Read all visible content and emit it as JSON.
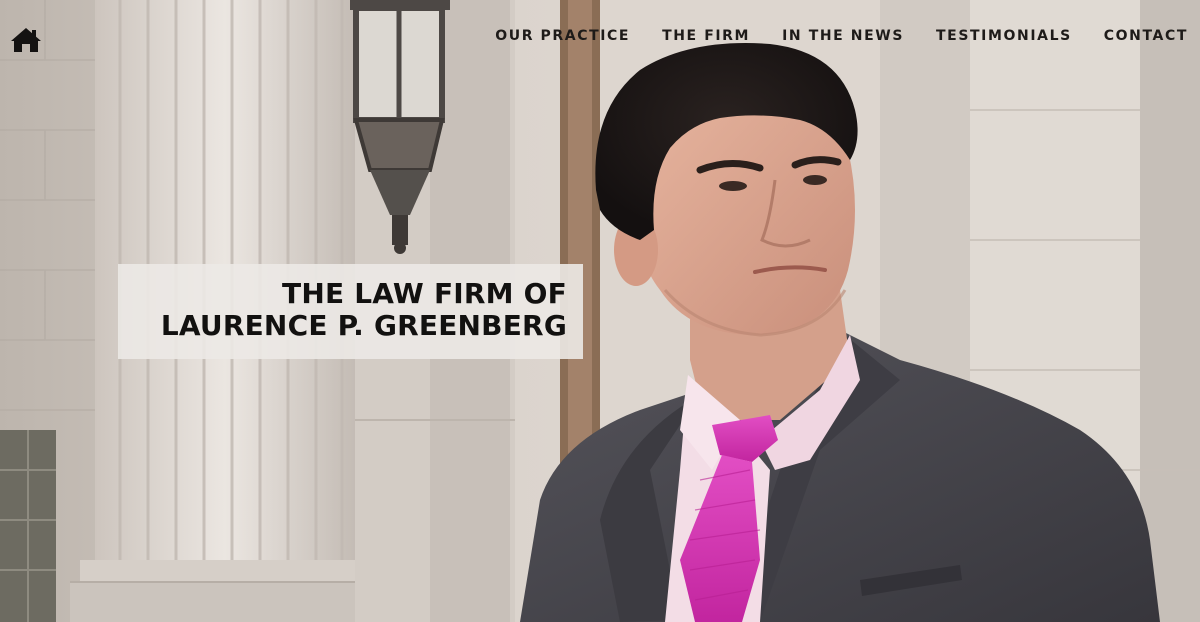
{
  "nav": {
    "home_icon": "home-icon",
    "items": [
      {
        "label": "OUR PRACTICE"
      },
      {
        "label": "THE FIRM"
      },
      {
        "label": "IN THE NEWS"
      },
      {
        "label": "TESTIMONIALS"
      },
      {
        "label": "CONTACT"
      }
    ]
  },
  "hero": {
    "title_line_1": "THE LAW FIRM OF",
    "title_line_2": "LAURENCE P. GREENBERG"
  },
  "colors": {
    "nav_text": "#1e1b19",
    "title_text": "#121110",
    "suit": "#45444a",
    "shirt": "#f3dde6",
    "tie": "#d634b2",
    "stone": "#d7d0c9"
  }
}
